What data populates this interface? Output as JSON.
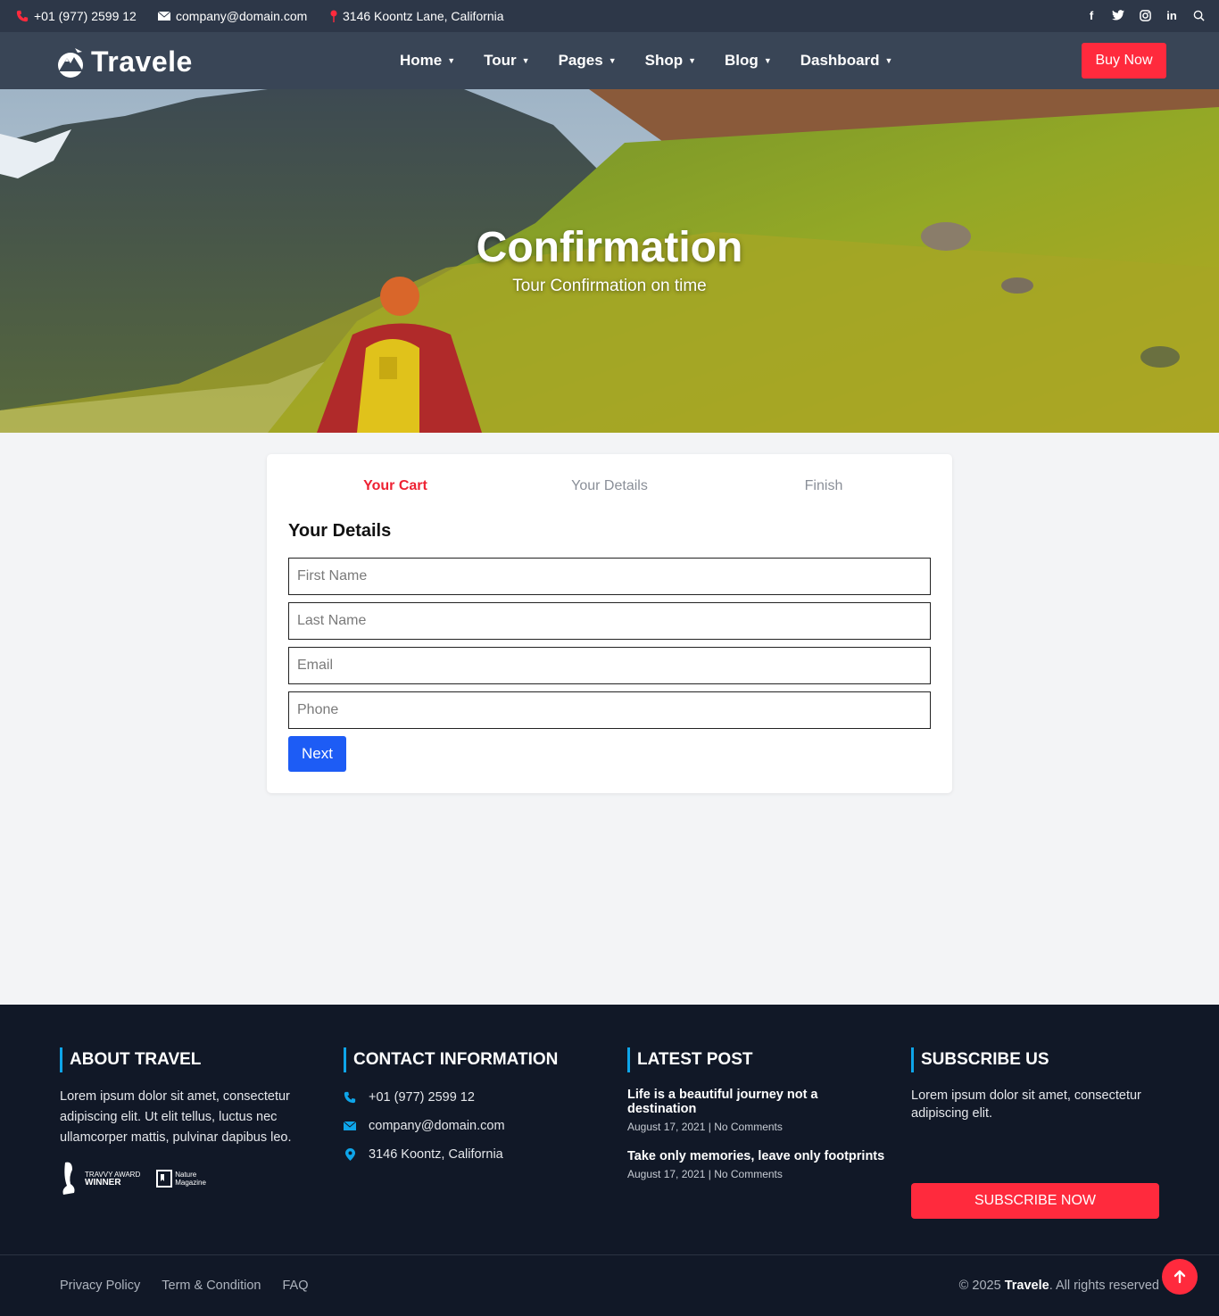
{
  "topbar": {
    "phone": "+01 (977) 2599 12",
    "email": "company@domain.com",
    "address": "3146 Koontz Lane, California",
    "socials": [
      "facebook-icon",
      "twitter-icon",
      "instagram-icon",
      "linkedin-icon",
      "search-icon"
    ]
  },
  "nav": {
    "logo": "Travele",
    "menu": [
      "Home",
      "Tour",
      "Pages",
      "Shop",
      "Blog",
      "Dashboard"
    ],
    "cta": "Buy Now"
  },
  "hero": {
    "title": "Confirmation",
    "subtitle": "Tour Confirmation on time"
  },
  "checkout": {
    "steps": [
      "Your Cart",
      "Your Details",
      "Finish"
    ],
    "active_step": "Your Cart",
    "heading": "Your Details",
    "fields": {
      "first_name": "First Name",
      "last_name": "Last Name",
      "email": "Email",
      "phone": "Phone"
    },
    "next_label": "Next"
  },
  "footer": {
    "about": {
      "heading": "About Travel",
      "text": "Lorem ipsum dolor sit amet, consectetur adipiscing elit. Ut elit tellus, luctus nec ullamcorper mattis, pulvinar dapibus leo.",
      "award1_line1": "TRAVVY AWARD",
      "award1_line2": "WINNER",
      "award2_line1": "Nature",
      "award2_line2": "Magazine"
    },
    "contact": {
      "heading": "Contact Information",
      "phone": "+01 (977) 2599 12",
      "email": "company@domain.com",
      "address": "3146 Koontz, California"
    },
    "latest": {
      "heading": "Latest Post",
      "posts": [
        {
          "title": "Life is a beautiful journey not a destination",
          "date": "August 17, 2021",
          "comments": "No Comments"
        },
        {
          "title": "Take only memories, leave only footprints",
          "date": "August 17, 2021",
          "comments": "No Comments"
        }
      ]
    },
    "subscribe": {
      "heading": "Subscribe Us",
      "text": "Lorem ipsum dolor sit amet, consectetur adipiscing elit.",
      "button": "Subscribe Now"
    },
    "links": [
      "Privacy Policy",
      "Term & Condition",
      "FAQ"
    ],
    "copyright_prefix": "© 2025",
    "copyright_brand": "Travele",
    "copyright_suffix": ". All rights reserved"
  },
  "colors": {
    "accent": "#ff2a3d",
    "primary": "#1d5cf5",
    "footer_bg": "#111827",
    "nav_bg": "#394556",
    "topbar_bg": "#2d3748",
    "info": "#0ea5e9"
  }
}
